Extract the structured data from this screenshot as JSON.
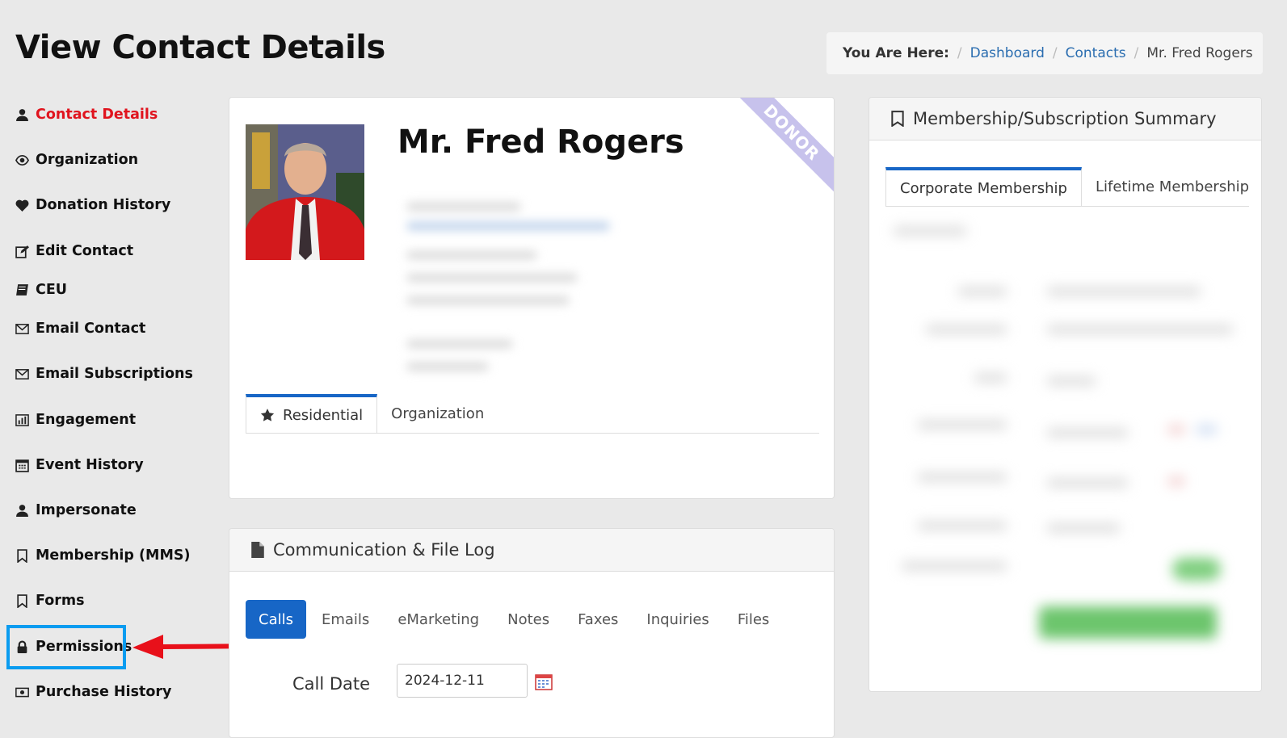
{
  "page": {
    "title": "View Contact Details"
  },
  "breadcrumb": {
    "label": "You Are Here:",
    "items": [
      "Dashboard",
      "Contacts"
    ],
    "current": "Mr. Fred Rogers"
  },
  "sidebar": {
    "items": [
      {
        "label": "Contact Details",
        "icon": "user-icon",
        "active": true
      },
      {
        "label": "Organization",
        "icon": "eye-icon"
      },
      {
        "label": "Donation History",
        "icon": "heart-icon"
      },
      {
        "label": "Edit Contact",
        "icon": "edit-icon"
      },
      {
        "label": "CEU",
        "icon": "book-icon"
      },
      {
        "label": "Email Contact",
        "icon": "envelope-icon"
      },
      {
        "label": "Email Subscriptions",
        "icon": "envelope-icon"
      },
      {
        "label": "Engagement",
        "icon": "bar-chart-icon"
      },
      {
        "label": "Event History",
        "icon": "calendar-icon"
      },
      {
        "label": "Impersonate",
        "icon": "user-icon"
      },
      {
        "label": "Membership (MMS)",
        "icon": "bookmark-icon"
      },
      {
        "label": "Forms",
        "icon": "bookmark-icon"
      },
      {
        "label": "Permissions",
        "icon": "lock-icon"
      },
      {
        "label": "Purchase History",
        "icon": "money-icon"
      }
    ],
    "accent_color": "#e0141e"
  },
  "contact": {
    "name": "Mr. Fred Rogers",
    "ribbon": "DONOR",
    "tabs": [
      "Residential",
      "Organization"
    ],
    "active_tab": "Residential"
  },
  "communication": {
    "title": "Communication & File Log",
    "tabs": [
      "Calls",
      "Emails",
      "eMarketing",
      "Notes",
      "Faxes",
      "Inquiries",
      "Files"
    ],
    "active_tab": "Calls",
    "call_date_label": "Call Date",
    "call_date_value": "2024-12-11"
  },
  "membership": {
    "title": "Membership/Subscription Summary",
    "tabs": [
      "Corporate Membership",
      "Lifetime Membership"
    ],
    "active_tab": "Corporate Membership"
  },
  "colors": {
    "primary": "#1766c6",
    "link": "#2a6db0",
    "annotation_box": "#0a9cf0",
    "annotation_arrow": "#e8101a",
    "ribbon": "#c7c2ec"
  }
}
